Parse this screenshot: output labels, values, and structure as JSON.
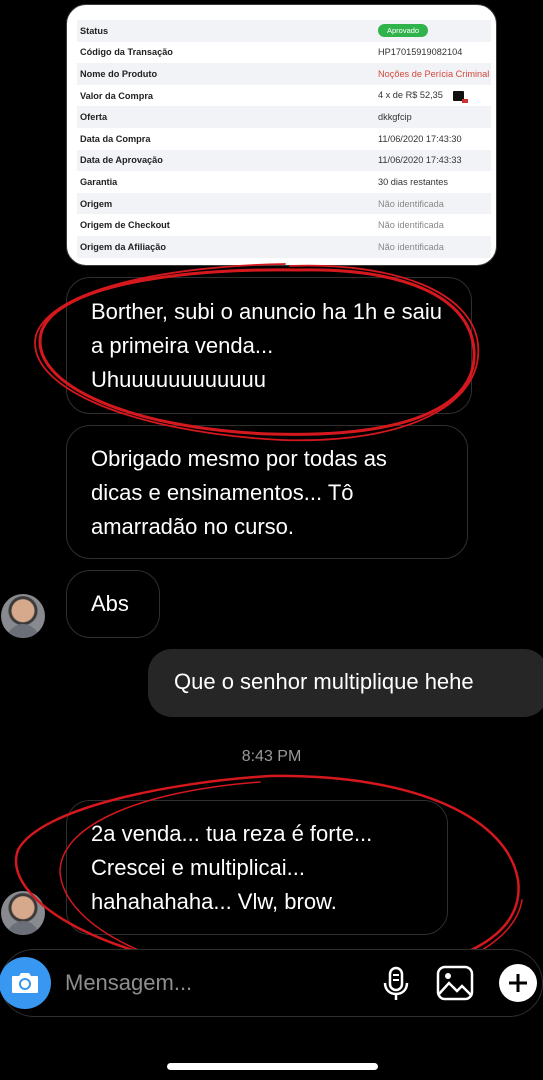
{
  "transaction": {
    "rows": [
      {
        "label": "Status",
        "value": "Aprovado"
      },
      {
        "label": "Código da Transação",
        "value": "HP17015919082104"
      },
      {
        "label": "Nome do Produto",
        "value": "Noções de Perícia Criminal"
      },
      {
        "label": "Valor da Compra",
        "value": "4 x de R$ 52,35"
      },
      {
        "label": "Oferta",
        "value": "dkkgfcip"
      },
      {
        "label": "Data da Compra",
        "value": "11/06/2020 17:43:30"
      },
      {
        "label": "Data de Aprovação",
        "value": "11/06/2020 17:43:33"
      },
      {
        "label": "Garantia",
        "value": "30 dias restantes"
      },
      {
        "label": "Origem",
        "value": "Não identificada"
      },
      {
        "label": "Origem de Checkout",
        "value": "Não identificada"
      },
      {
        "label": "Origem da Afiliação",
        "value": "Não identificada"
      }
    ],
    "status_color": "#2fb34a",
    "product_color": "#d2483d"
  },
  "messages": {
    "m1": "Borther, subi o anuncio ha 1h e saiu a primeira venda... Uhuuuuuuuuuuuu",
    "m2": "Obrigado mesmo por todas as dicas e ensinamentos... Tô amarradão no curso.",
    "m3": "Abs",
    "m4": "Que o senhor multiplique hehe",
    "m5": "2a venda... tua reza é forte... Crescei e multiplicai... hahahahaha... Vlw, brow."
  },
  "timestamp": "8:43 PM",
  "composer": {
    "placeholder": "Mensagem...",
    "icons": [
      "camera-icon",
      "microphone-icon",
      "gallery-icon",
      "plus-icon"
    ],
    "camera_color": "#3897f0"
  },
  "annotation_color": "#d4181e"
}
